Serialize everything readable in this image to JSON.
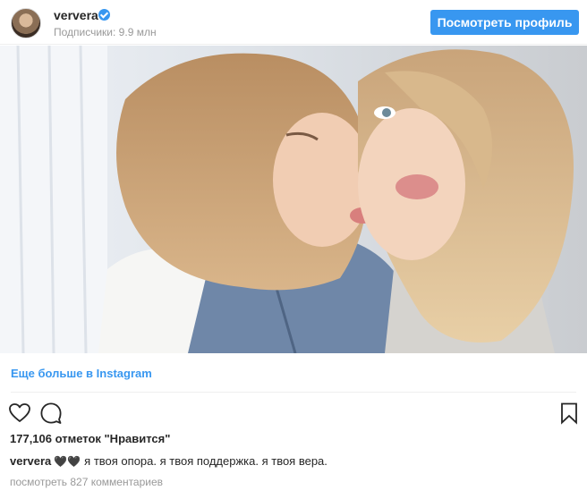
{
  "header": {
    "username": "ververa",
    "subscribers": "Подписчики: 9.9 млн",
    "profile_button": "Посмотреть профиль"
  },
  "post": {
    "more_link": "Еще больше в Instagram",
    "likes": "177,106 отметок \"Нравится\"",
    "caption_user": "ververa",
    "caption_hearts": "🖤🖤",
    "caption_text": "я твоя опора. я твоя поддержка. я твоя вера.",
    "comments_link": "посмотреть 827 комментариев"
  },
  "icons": {
    "verified": "verified-badge-icon",
    "like": "heart-icon",
    "comment": "comment-icon",
    "save": "bookmark-icon"
  },
  "colors": {
    "accent": "#3897f0",
    "text": "#262626",
    "muted": "#999999"
  }
}
